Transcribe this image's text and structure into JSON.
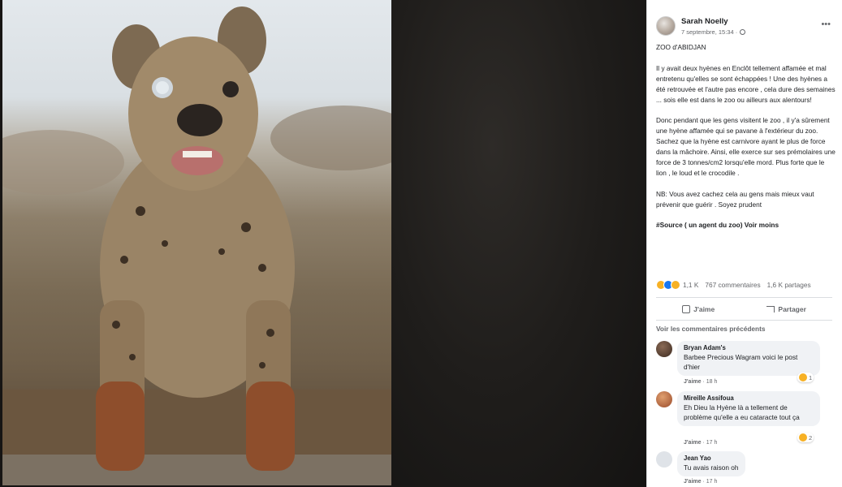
{
  "post": {
    "author": "Sarah Noelly",
    "date": "7 septembre, 15:34 ·",
    "more_label": "•••",
    "paragraphs": [
      "ZOO d'ABIDJAN",
      "Il y avait deux hyènes en Enclôt tellement affamée et mal entretenu qu'elles se sont échappées ! Une des hyènes a été retrouvée et l'autre pas encore , cela dure des semaines ... sois elle est dans le zoo ou ailleurs aux alentours!",
      "Donc pendant que les gens visitent le zoo , il y'a sûrement une hyène affamée qui se pavane à l'extérieur du zoo.",
      "Sachez que la hyène est carnivore ayant le plus de force dans la mâchoire. Ainsi, elle exerce sur ses prémolaires une force de 3 tonnes/cm2 lorsqu'elle mord. Plus forte que le lion , le loud et le crocodile .",
      "NB: Vous avez cachez cela au gens mais mieux vaut prévenir que guérir . Soyez prudent"
    ],
    "source_text": "#Source ( un agent du zoo)",
    "see_less": "Voir moins",
    "reaction_count": "1,1 K",
    "comments_count": "767 commentaires",
    "shares_count": "1,6 K partages",
    "like_label": "J'aime",
    "share_label": "Partager",
    "view_previous": "Voir les commentaires précédents"
  },
  "comments": [
    {
      "name": "Bryan Adam's",
      "text": "Barbee Precious Wagram voici le post d'hier",
      "like": "J'aime",
      "time": "· 18 h",
      "reactions": "1"
    },
    {
      "name": "Mireille Assifoua",
      "text": "Eh Dieu la Hyène là a tellement de problème qu'elle a eu cataracte tout ça",
      "like": "J'aime",
      "time": "· 17 h",
      "reactions": "2"
    },
    {
      "name": "Jean Yao",
      "text": "Tu avais raison oh",
      "like": "J'aime",
      "time": "· 17 h"
    }
  ],
  "colors": {
    "accent": "#1877f2",
    "reaction_yellow": "#f7b125",
    "panel_bg": "#ffffff",
    "bubble_bg": "#f0f2f5"
  },
  "icons": {
    "privacy": "globe-icon",
    "more": "more-options-icon",
    "like": "thumbs-up-icon",
    "share": "share-arrow-icon"
  }
}
